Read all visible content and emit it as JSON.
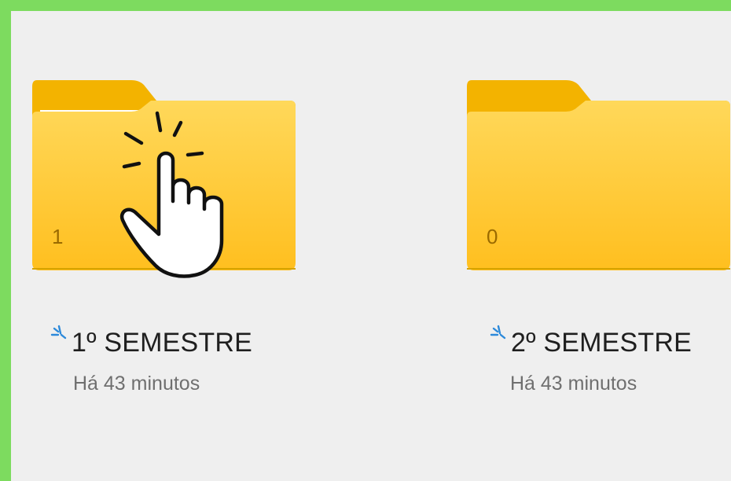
{
  "colors": {
    "frame_border": "#7ddb5f",
    "background": "#efefef",
    "folder_front_top": "#ffd85a",
    "folder_front_bottom": "#ffbf1f",
    "folder_back": "#f3b300",
    "sync_icon": "#2c89da"
  },
  "icons": {
    "folder": "folder-icon",
    "sync": "sync-pending-icon",
    "pointer": "hand-click-icon"
  },
  "folders": [
    {
      "count": "1",
      "name": "1º SEMESTRE",
      "modified": "Há 43 minutos",
      "has_file_preview": true,
      "cursor_over": true
    },
    {
      "count": "0",
      "name": "2º SEMESTRE",
      "modified": "Há 43 minutos",
      "has_file_preview": false,
      "cursor_over": false
    }
  ]
}
